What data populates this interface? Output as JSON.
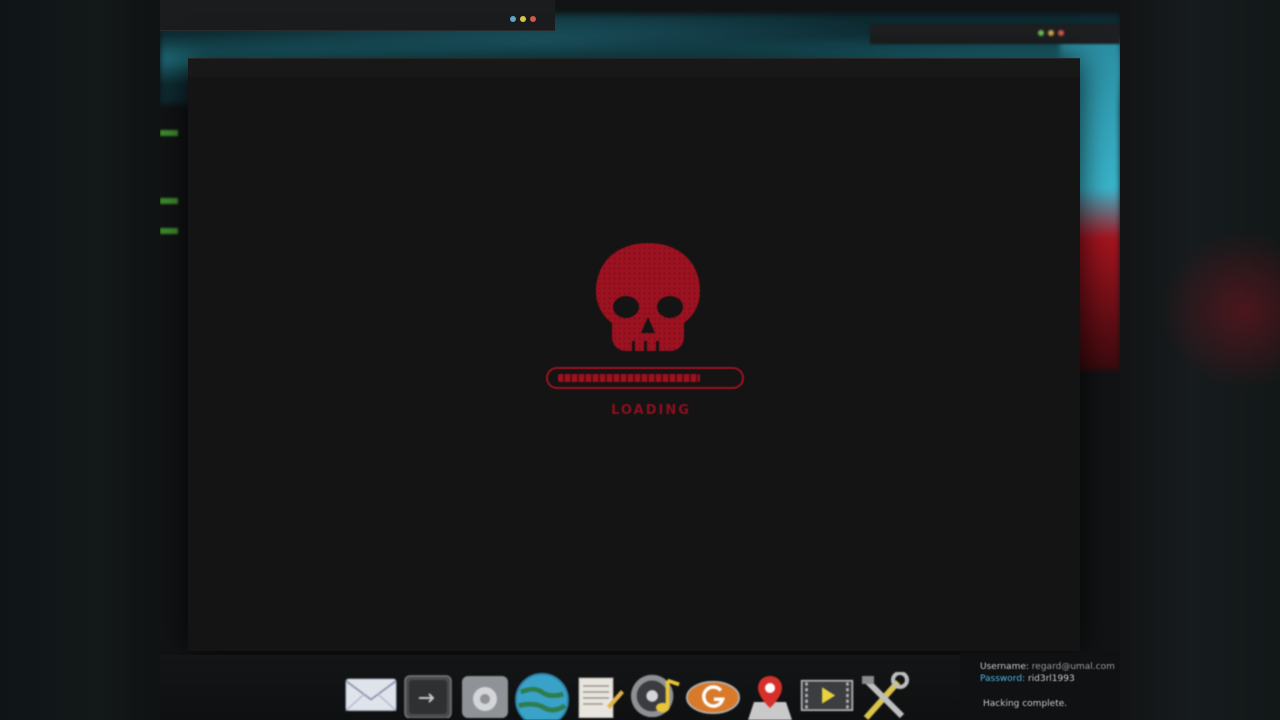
{
  "loader": {
    "status_text": "LOADING",
    "progress_percent": 80,
    "accent_color": "#9c1220",
    "icon": "skull-icon"
  },
  "dock": {
    "items": [
      {
        "icon": "mail-icon"
      },
      {
        "icon": "terminal-icon"
      },
      {
        "icon": "settings-icon"
      },
      {
        "icon": "globe-icon"
      },
      {
        "icon": "notes-icon"
      },
      {
        "icon": "music-icon"
      },
      {
        "icon": "browser-g-icon"
      },
      {
        "icon": "maps-icon"
      },
      {
        "icon": "video-player-icon"
      },
      {
        "icon": "tools-icon"
      }
    ]
  },
  "credentials": {
    "username_label": "Username:",
    "username_value": "regard@umal.com",
    "password_label": "Password:",
    "password_value": "rid3rl1993",
    "status": "Hacking complete."
  },
  "colors": {
    "window_bg": "#141414",
    "password_label": "#4fb4e6",
    "text_light": "#c9c9c9"
  }
}
